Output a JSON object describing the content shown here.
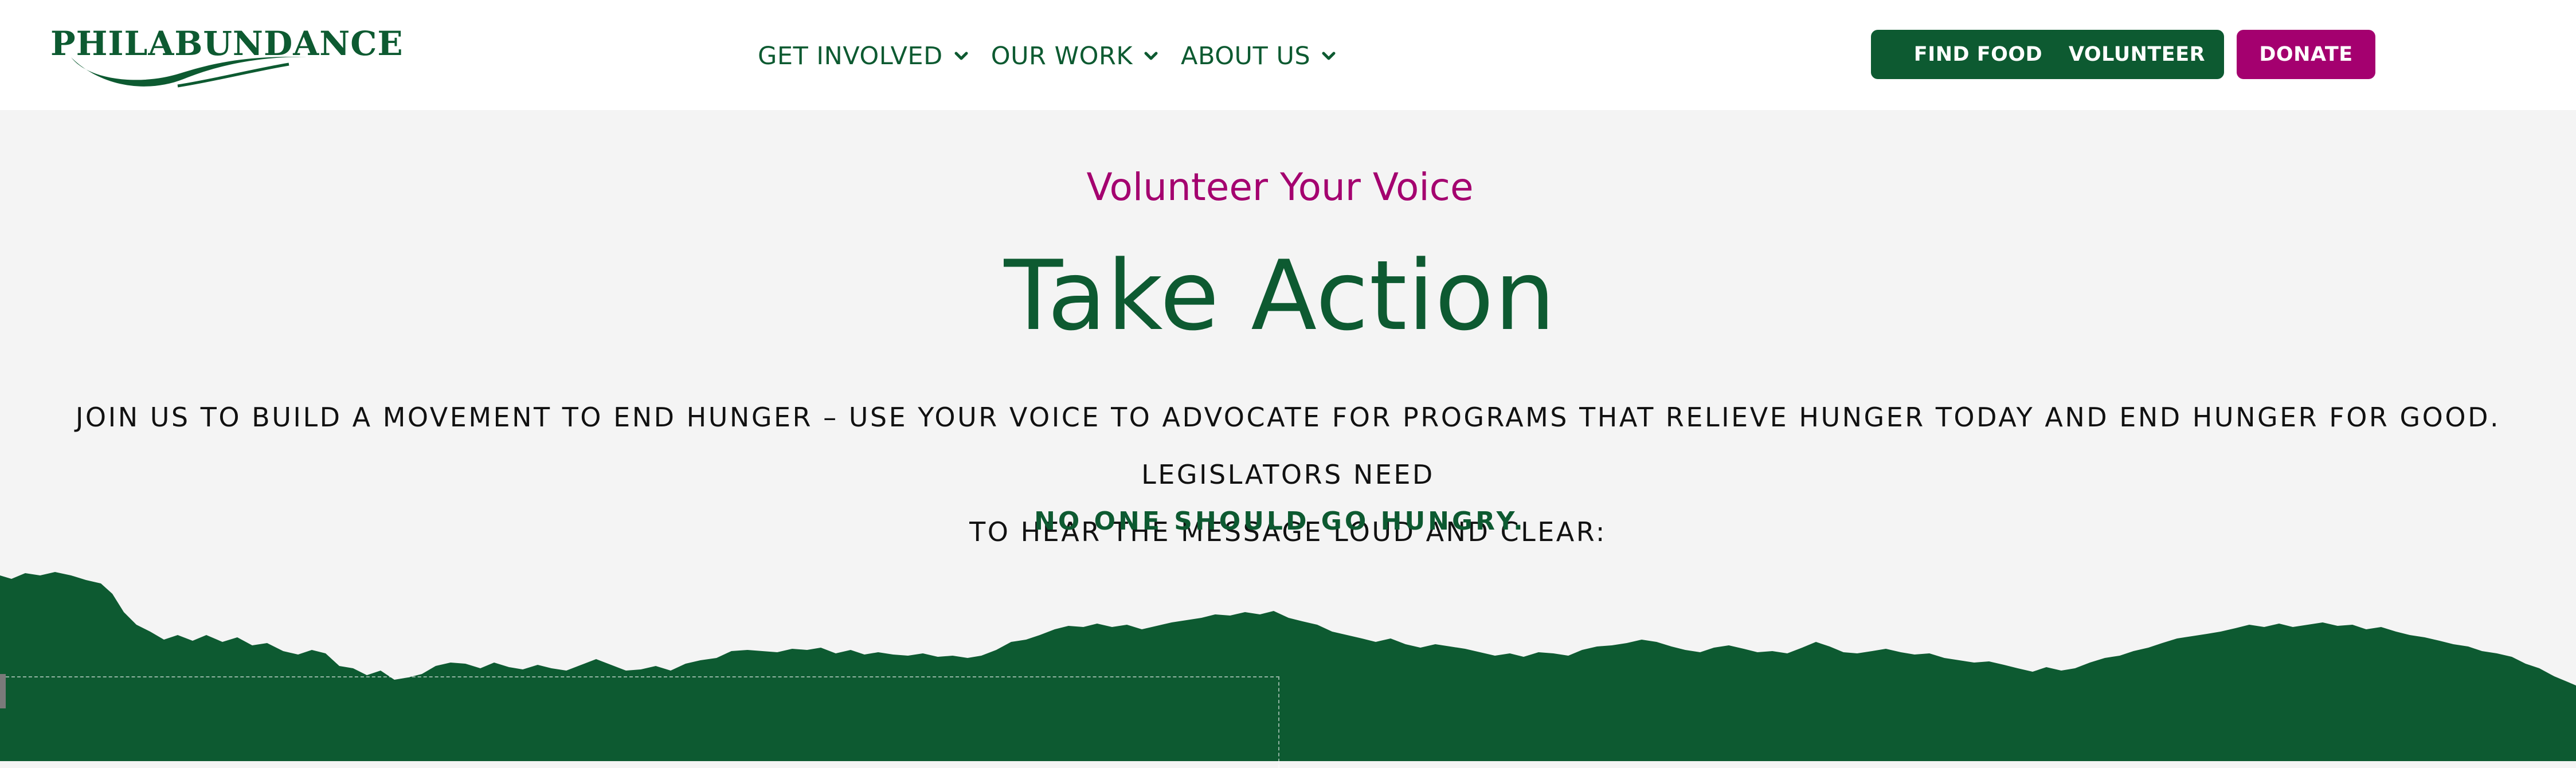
{
  "header": {
    "logo_text": "PHILABUNDANCE",
    "nav": [
      {
        "label": "GET INVOLVED"
      },
      {
        "label": "OUR WORK"
      },
      {
        "label": "ABOUT US"
      }
    ],
    "buttons": {
      "find_food": "FIND FOOD",
      "volunteer": "VOLUNTEER",
      "donate": "DONATE"
    }
  },
  "hero": {
    "eyebrow": "Volunteer Your Voice",
    "title": "Take Action",
    "body_line1": "JOIN US TO BUILD A MOVEMENT TO END HUNGER – USE YOUR VOICE TO ADVOCATE FOR PROGRAMS THAT RELIEVE HUNGER TODAY AND END HUNGER FOR GOOD. LEGISLATORS NEED",
    "body_line2": "TO HEAR THE MESSAGE LOUD AND CLEAR:",
    "emphasis": "NO ONE SHOULD GO HUNGRY."
  },
  "colors": {
    "brand_green": "#0d5a31",
    "brand_magenta": "#a4006f",
    "hero_background": "#f4f4f4",
    "header_background": "#ffffff"
  },
  "icons": {
    "nav_dropdown": "chevron-down-icon",
    "logo_swoosh": "swoosh-icon"
  }
}
